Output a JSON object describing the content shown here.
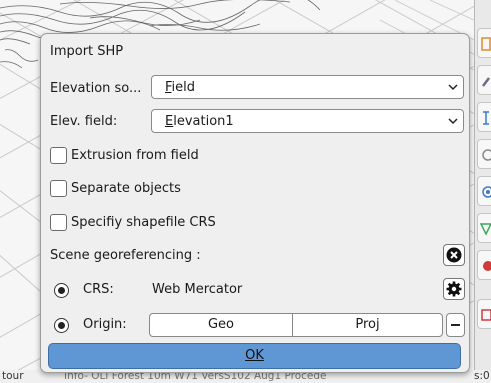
{
  "dialog": {
    "title": "Import SHP",
    "elevation_source": {
      "label": "Elevation so...",
      "value_first": "F",
      "value_rest": "ield"
    },
    "elev_field": {
      "label": "Elev. field:",
      "value_first": "E",
      "value_rest": "levation1"
    },
    "extrusion": {
      "label": "Extrusion from field",
      "checked": false
    },
    "separate": {
      "label": "Separate objects",
      "checked": false
    },
    "specify_crs": {
      "label": "Specifiy shapefile CRS",
      "checked": false
    },
    "scene_georef": {
      "label": "Scene georeferencing :"
    },
    "crs": {
      "label": "CRS:",
      "value": "Web Mercator"
    },
    "origin": {
      "label": "Origin:",
      "options": [
        "Geo",
        "Proj"
      ]
    },
    "ok_label": "OK"
  },
  "statusbar": {
    "left": "tour",
    "main": "Info- OLI Forest 10m W71 VersS102 Aug1 Procede",
    "right": "s:0"
  },
  "icons": {
    "close_settings": "close-circle-icon",
    "crs_settings": "gear-icon",
    "dropdown": "chevron-down-icon"
  },
  "colors": {
    "ok_button": "#5f97d5",
    "dialog_bg": "#efefef"
  }
}
